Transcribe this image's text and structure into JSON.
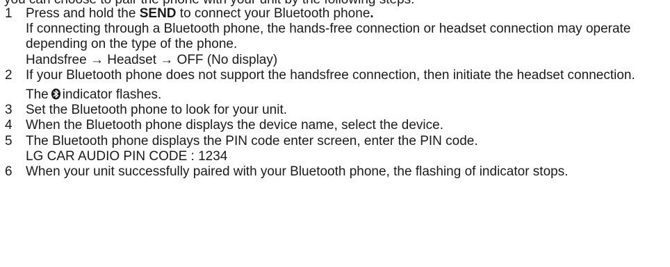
{
  "cut_line": {
    "text": "you can choose to pair the phone with your unit by the following steps."
  },
  "steps": [
    {
      "number": "1",
      "l1_pre": "Press and hold the ",
      "l1_bold": "SEND",
      "l1_mid": " to connect your Bluetooth phone",
      "l1_end": ".",
      "l2": "If connecting through a Bluetooth phone, the hands-free connection or headset connection may operate depending on the type of the phone.",
      "l3": "Handsfree → Headset → OFF (No display)"
    },
    {
      "number": "2",
      "l1": "If your Bluetooth phone does not support the handsfree connection, then initiate the headset connection.",
      "l2_pre": "The",
      "icon": "bluetooth-icon",
      "l2_post": "indicator flashes."
    },
    {
      "number": "3",
      "l1": "Set the Bluetooth phone to look for your unit."
    },
    {
      "number": "4",
      "l1": "When the Bluetooth phone displays the device name, select the device."
    },
    {
      "number": "5",
      "l1": "The Bluetooth phone displays the PIN code enter screen, enter the PIN code.",
      "l2": "LG CAR AUDIO PIN CODE : 1234"
    },
    {
      "number": "6",
      "l1": "When your unit successfully paired with your Bluetooth phone, the flashing of indicator stops."
    }
  ]
}
